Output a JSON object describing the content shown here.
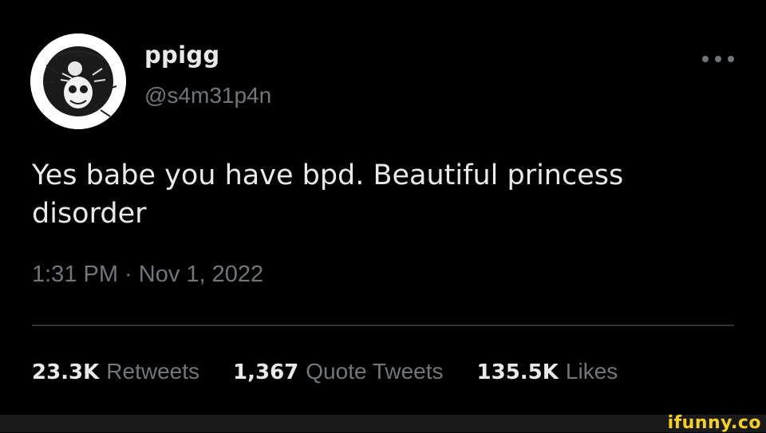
{
  "tweet": {
    "author": {
      "display_name": "ppigg",
      "handle": "@s4m31p4n",
      "avatar_icon": "skull-patch-avatar-icon"
    },
    "more_icon": "more-horizontal-icon",
    "text": "Yes babe you have bpd. Beautiful princess\ndisorder",
    "timestamp": "1:31 PM · Nov 1, 2022",
    "stats": {
      "retweets": {
        "count": "23.3K",
        "label": "Retweets"
      },
      "quote_tweets": {
        "count": "1,367",
        "label": "Quote Tweets"
      },
      "likes": {
        "count": "135.5K",
        "label": "Likes"
      }
    }
  },
  "watermark": {
    "text": "ifunny.co",
    "color": "#f5d020"
  },
  "colors": {
    "background": "#000000",
    "primary_text": "#e7e9ea",
    "secondary_text": "#71767b",
    "divider": "#2f3336"
  }
}
